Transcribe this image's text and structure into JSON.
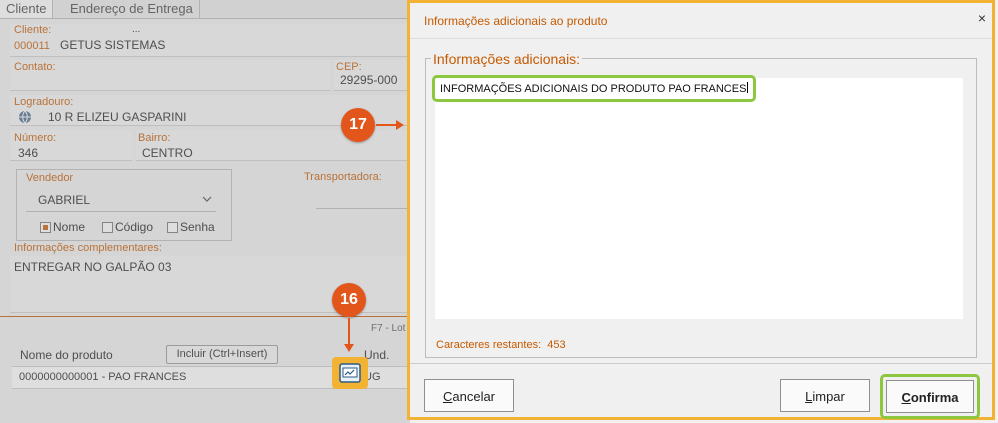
{
  "tabs": [
    {
      "label": "Cliente"
    },
    {
      "label": "Endereço de Entrega"
    }
  ],
  "form": {
    "cliente_label": "Cliente:",
    "cliente_code": "000011",
    "cliente_name": "GETUS SISTEMAS",
    "cliente_dots": "...",
    "contato_label": "Contato:",
    "cep_label": "CEP:",
    "cep_value": "29295-000",
    "logradouro_label": "Logradouro:",
    "logradouro_value": "10 R ELIZEU GASPARINI",
    "numero_label": "Número:",
    "numero_value": "346",
    "bairro_label": "Bairro:",
    "bairro_value": "CENTRO",
    "vendedor_label": "Vendedor",
    "vendedor_value": "GABRIEL",
    "opt_nome": "Nome",
    "opt_codigo": "Código",
    "opt_senha": "Senha",
    "transportadora_label": "Transportadora:",
    "info_comp_label": "Informações complementares:",
    "info_comp_value": "ENTREGAR NO GALPÃO 03",
    "f7_label": "F7 - Lot"
  },
  "products": {
    "col_nome": "Nome do produto",
    "incluir_button": "Incluir (Ctrl+Insert)",
    "col_und": "Und.",
    "rows": [
      {
        "nome": "0000000000001 - PAO FRANCES",
        "und": "UG"
      }
    ]
  },
  "markers": {
    "step16": "16",
    "step17": "17"
  },
  "dialog": {
    "title": "Informações adicionais ao produto",
    "close": "×",
    "group_label": "Informações adicionais:",
    "text_value": "INFORMAÇÕES ADICIONAIS DO PRODUTO PAO FRANCES",
    "counter_label": "Caracteres restantes:",
    "counter_value": "453",
    "cancel_first": "C",
    "cancel_rest": "ancelar",
    "clear_first": "L",
    "clear_rest": "impar",
    "confirm_first": "C",
    "confirm_rest": "onfirma"
  },
  "colors": {
    "accent": "#c65a00",
    "marker": "#e2561c",
    "highlight_green": "#8dc63f",
    "dialog_border": "#f2b233"
  }
}
